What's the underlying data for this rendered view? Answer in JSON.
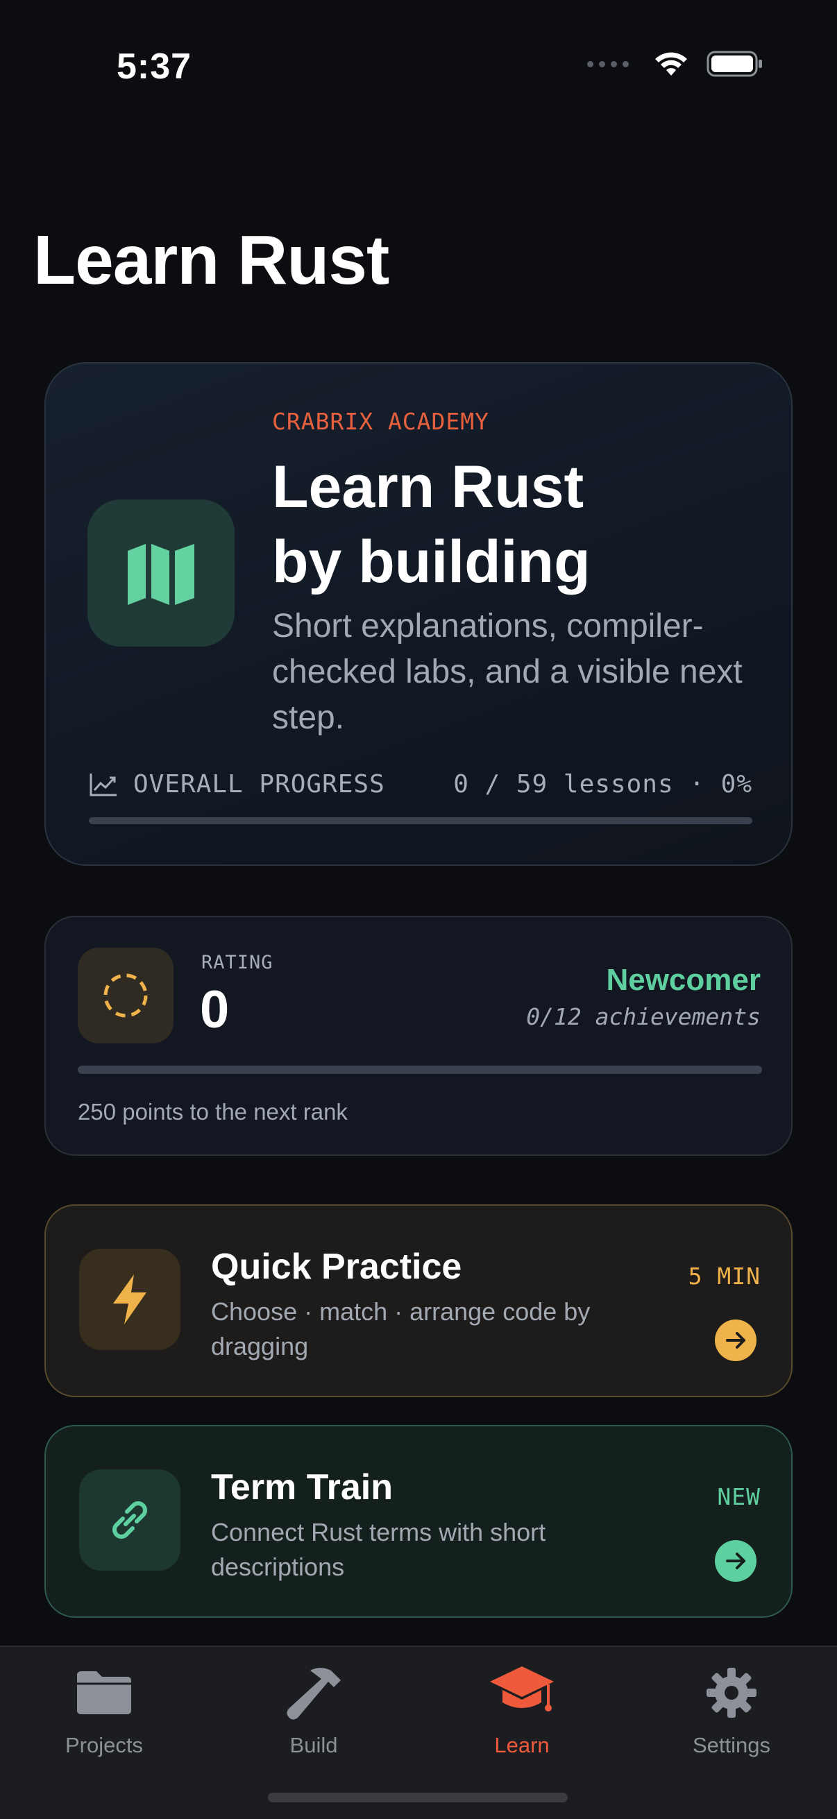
{
  "status": {
    "time": "5:37"
  },
  "page": {
    "title": "Learn Rust"
  },
  "hero": {
    "eyebrow": "CRABRIX ACADEMY",
    "title_line1": "Learn Rust",
    "title_line2": "by building",
    "subtitle": "Short explanations, compiler-checked labs, and a visible next step.",
    "progress_label": "OVERALL PROGRESS",
    "progress_value": "0 / 59 lessons · 0%",
    "progress_fraction": 0,
    "accent_color": "#64d2a0",
    "icon": "map-icon"
  },
  "rating": {
    "label": "RATING",
    "value": "0",
    "rank": "Newcomer",
    "achievements": "0/12 achievements",
    "progress_fraction": 0,
    "next_rank_note": "250 points to the next rank",
    "icon": "dashed-circle-icon",
    "accent_color": "#f0b24a"
  },
  "practice": {
    "title": "Quick Practice",
    "description": "Choose · match · arrange code by dragging",
    "badge": "5 MIN",
    "icon": "bolt-icon",
    "accent_color": "#f0b24a"
  },
  "terms": {
    "title": "Term Train",
    "description": "Connect Rust terms with short descriptions",
    "badge": "NEW",
    "icon": "link-icon",
    "accent_color": "#5ed0a0"
  },
  "tabbar": {
    "items": [
      {
        "label": "Projects",
        "icon": "folder-icon"
      },
      {
        "label": "Build",
        "icon": "hammer-icon"
      },
      {
        "label": "Learn",
        "icon": "graduation-cap-icon",
        "active": true
      },
      {
        "label": "Settings",
        "icon": "gear-icon"
      }
    ],
    "active_color": "#ef5a3c"
  }
}
